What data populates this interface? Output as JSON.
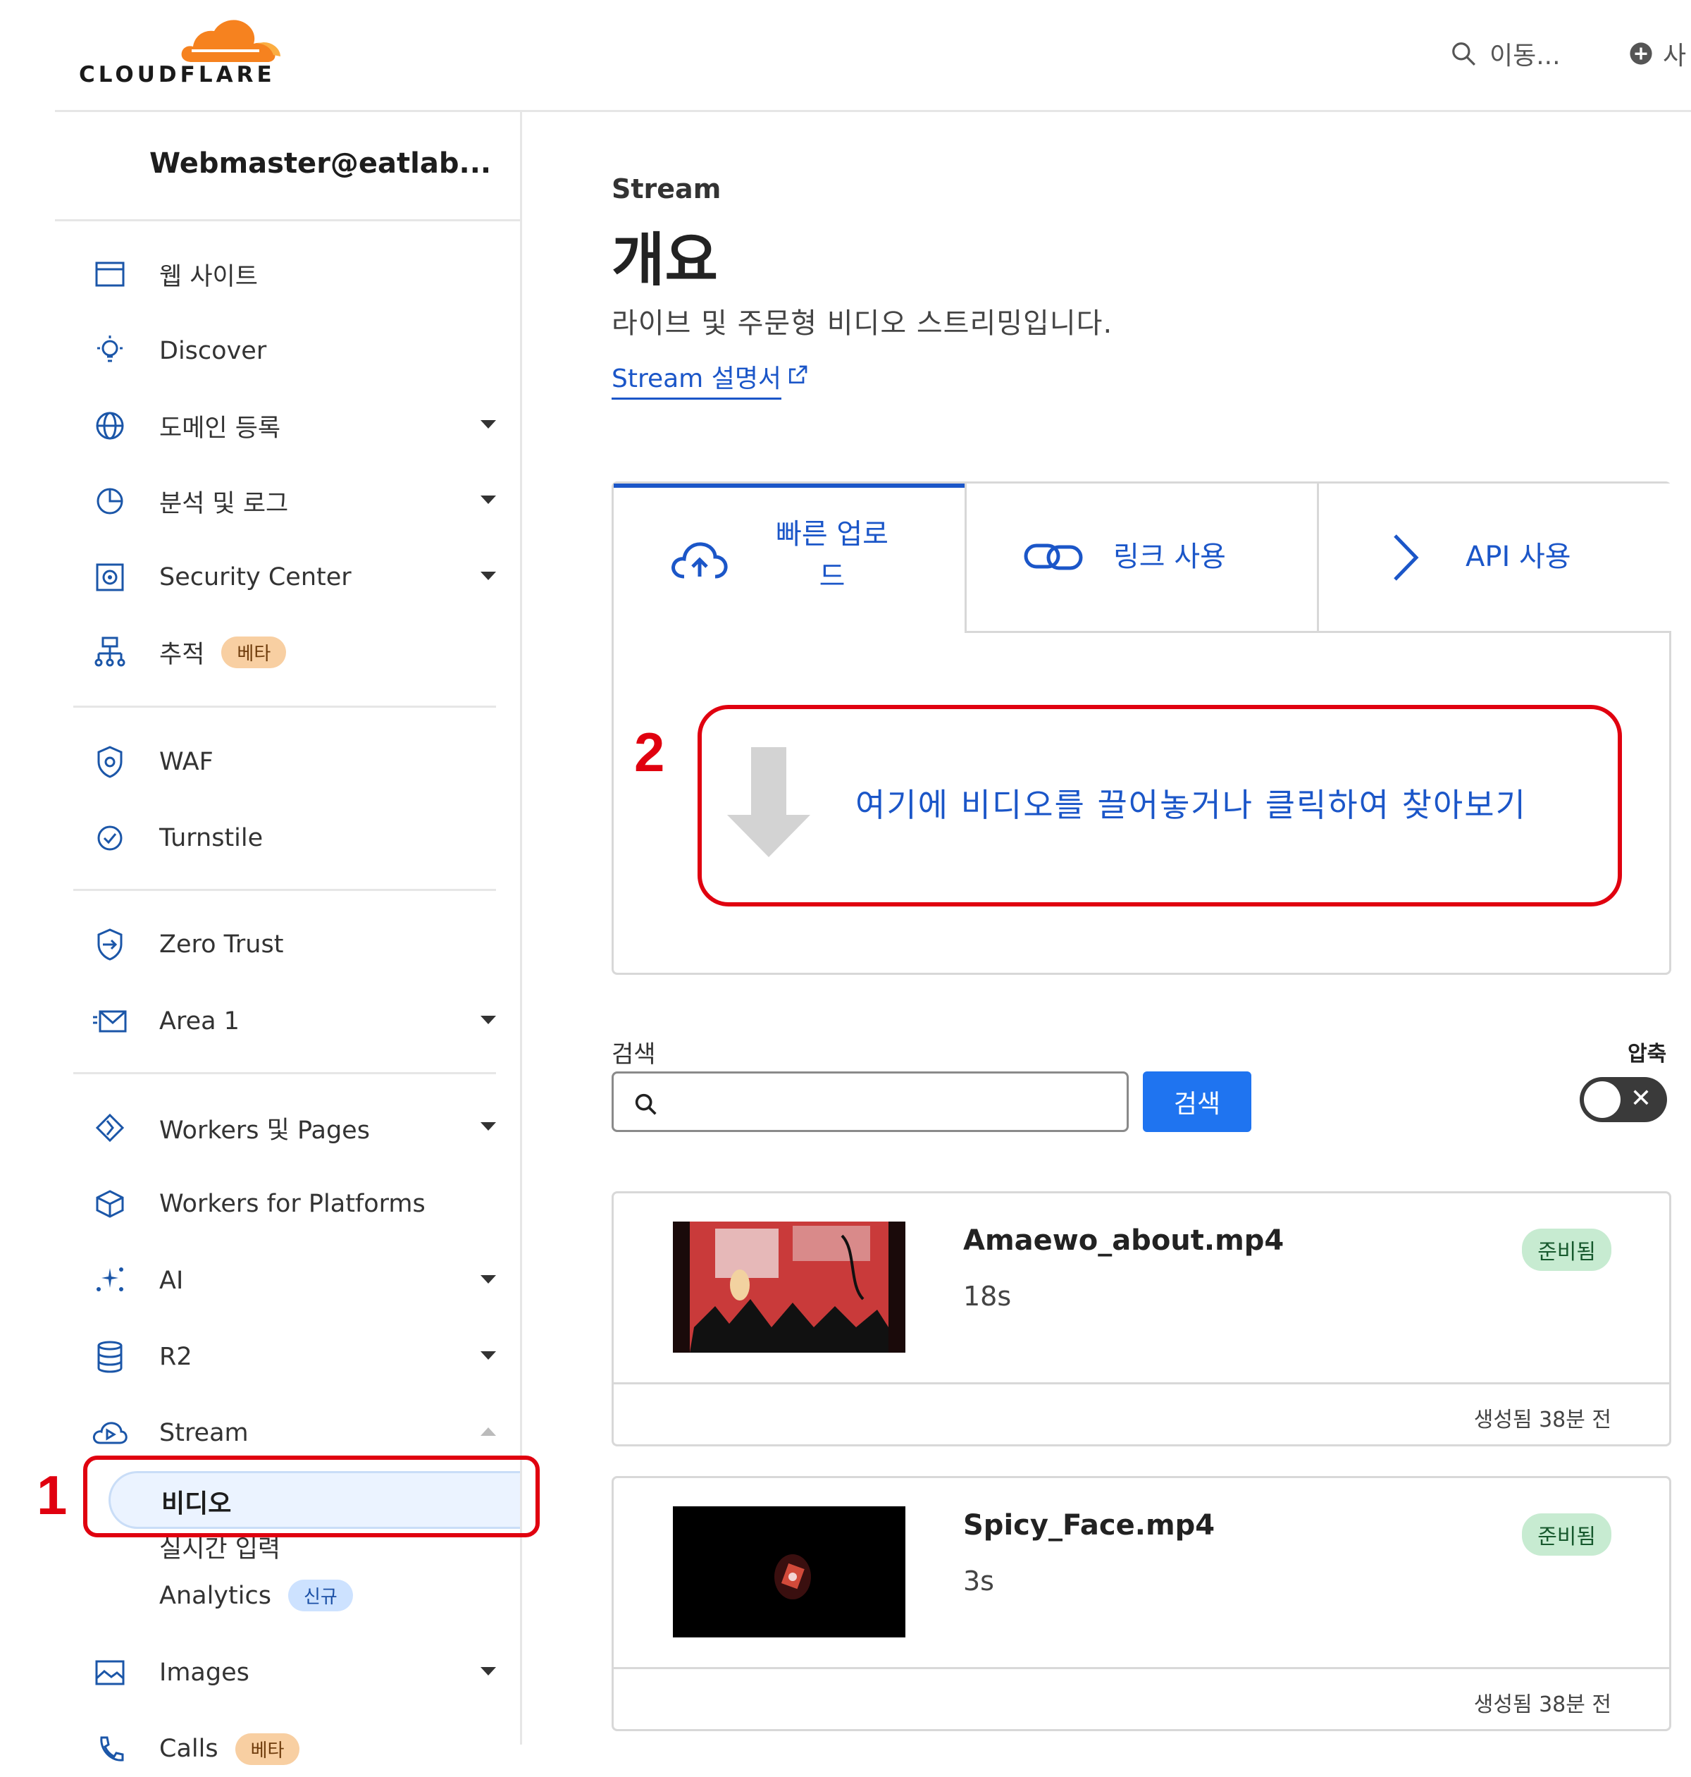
{
  "brand": {
    "name": "CLOUDFLARE",
    "accent": "#f6821f"
  },
  "header": {
    "search_label": "이동...",
    "add_label": "사"
  },
  "sidebar": {
    "account": "Webmaster@eatlab...",
    "items": [
      {
        "label": "웹 사이트",
        "icon": "browser-window-icon"
      },
      {
        "label": "Discover",
        "icon": "lightbulb-icon"
      },
      {
        "label": "도메인 등록",
        "icon": "globe-icon"
      },
      {
        "label": "분석 및 로그",
        "icon": "pie-chart-icon"
      },
      {
        "label": "Security Center",
        "icon": "security-center-icon"
      },
      {
        "label": "추적",
        "icon": "trace-tree-icon",
        "badge": "베타"
      },
      {
        "label": "WAF",
        "icon": "waf-shield-icon"
      },
      {
        "label": "Turnstile",
        "icon": "turnstile-check-icon"
      },
      {
        "label": "Zero Trust",
        "icon": "zero-trust-icon"
      },
      {
        "label": "Area 1",
        "icon": "email-icon"
      },
      {
        "label": "Workers 및 Pages",
        "icon": "workers-icon"
      },
      {
        "label": "Workers for Platforms",
        "icon": "box-icon"
      },
      {
        "label": "AI",
        "icon": "sparkle-icon"
      },
      {
        "label": "R2",
        "icon": "database-icon"
      },
      {
        "label": "Stream",
        "icon": "stream-cloud-icon"
      },
      {
        "label": "Images",
        "icon": "image-icon"
      },
      {
        "label": "Calls",
        "icon": "calls-icon",
        "badge": "베타"
      }
    ],
    "stream_sub": {
      "active": "비디오",
      "live": "실시간 입력",
      "analytics": "Analytics",
      "analytics_badge": "신규"
    }
  },
  "main": {
    "breadcrumb": "Stream",
    "title": "개요",
    "description": "라이브 및 주문형 비디오 스트리밍입니다.",
    "doc_link": "Stream 설명서",
    "tabs": [
      {
        "label_line1": "빠른 업로",
        "label_line2": "드"
      },
      {
        "label": "링크 사용"
      },
      {
        "label": "API 사용"
      }
    ],
    "dropzone": "여기에 비디오를 끌어놓거나 클릭하여 찾아보기",
    "search": {
      "label": "검색",
      "placeholder": "",
      "button": "검색"
    },
    "compress_label": "압축",
    "toggle_state": "off",
    "videos": [
      {
        "name": "Amaewo_about.mp4",
        "duration": "18s",
        "status": "준비됨",
        "created": "생성됨 38분 전"
      },
      {
        "name": "Spicy_Face.mp4",
        "duration": "3s",
        "status": "준비됨",
        "created": "생성됨 38분 전"
      }
    ]
  },
  "annotations": {
    "step1": "1",
    "step2": "2",
    "color": "#e0000f"
  }
}
